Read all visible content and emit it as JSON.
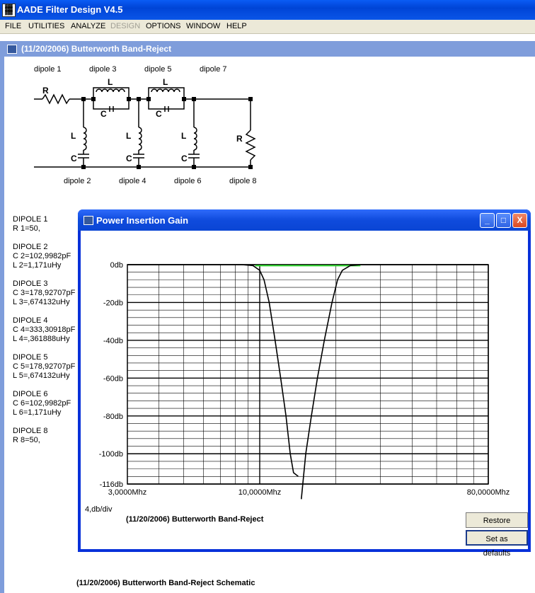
{
  "app": {
    "title": "AADE Filter Design V4.5"
  },
  "menu": [
    {
      "label": "FILE",
      "enabled": true
    },
    {
      "label": "UTILITIES",
      "enabled": true
    },
    {
      "label": "ANALYZE",
      "enabled": true
    },
    {
      "label": "DESIGN",
      "enabled": false
    },
    {
      "label": "OPTIONS",
      "enabled": true
    },
    {
      "label": "WINDOW",
      "enabled": true
    },
    {
      "label": "HELP",
      "enabled": true
    }
  ],
  "child_window": {
    "title": "(11/20/2006) Butterworth Band-Reject"
  },
  "schematic": {
    "top_labels": [
      "dipole 1",
      "dipole 3",
      "dipole 5",
      "dipole 7"
    ],
    "bottom_labels": [
      "dipole 2",
      "dipole 4",
      "dipole 6",
      "dipole 8"
    ],
    "symbols": {
      "R": "R",
      "L": "L",
      "C": "C"
    },
    "caption": "(11/20/2006) Butterworth Band-Reject Schematic"
  },
  "components": [
    {
      "name": "DIPOLE 1",
      "lines": [
        "R 1=50,"
      ]
    },
    {
      "name": "DIPOLE 2",
      "lines": [
        "C 2=102,9982pF",
        "L 2=1,171uHy"
      ]
    },
    {
      "name": "DIPOLE 3",
      "lines": [
        "C 3=178,92707pF",
        "L 3=,674132uHy"
      ]
    },
    {
      "name": "DIPOLE 4",
      "lines": [
        "C 4=333,30918pF",
        "L 4=,361888uHy"
      ]
    },
    {
      "name": "DIPOLE 5",
      "lines": [
        "C 5=178,92707pF",
        "L 5=,674132uHy"
      ]
    },
    {
      "name": "DIPOLE 6",
      "lines": [
        "C 6=102,9982pF",
        "L 6=1,171uHy"
      ]
    },
    {
      "name": "DIPOLE 8",
      "lines": [
        "R 8=50,"
      ]
    }
  ],
  "popup": {
    "title": "Power Insertion Gain",
    "scale_label": "4,db/div",
    "plot_caption": "(11/20/2006) Butterworth Band-Reject",
    "restore_label": "Restore defaults",
    "set_label": "Set as defaults",
    "controls": {
      "minimize": "_",
      "maximize": "□",
      "close": "X"
    }
  },
  "chart_data": {
    "type": "line",
    "x_scale": "log",
    "xlim": [
      3,
      80
    ],
    "ylim": [
      -116,
      0
    ],
    "x_tick_labels": [
      {
        "value": 3,
        "label": "3,0000Mhz"
      },
      {
        "value": 10,
        "label": "10,0000Mhz"
      },
      {
        "value": 80,
        "label": "80,0000Mhz"
      }
    ],
    "y_tick_labels": [
      {
        "value": 0,
        "label": "0db"
      },
      {
        "value": -20,
        "label": "-20db"
      },
      {
        "value": -40,
        "label": "-40db"
      },
      {
        "value": -60,
        "label": "-60db"
      },
      {
        "value": -80,
        "label": "-80db"
      },
      {
        "value": -100,
        "label": "-100db"
      },
      {
        "value": -116,
        "label": "-116db"
      }
    ],
    "minor_y_step": 4,
    "grid": true,
    "reference_line": {
      "y": -0.5,
      "x_range": [
        9.6,
        25
      ],
      "color": "#33dd33"
    },
    "series": [
      {
        "color": "#000000",
        "points": [
          [
            3,
            0
          ],
          [
            8.5,
            0
          ],
          [
            9.4,
            -0.5
          ],
          [
            10.0,
            -3
          ],
          [
            10.4,
            -8
          ],
          [
            10.9,
            -20
          ],
          [
            11.5,
            -40
          ],
          [
            12.1,
            -60
          ],
          [
            12.7,
            -80
          ],
          [
            13.2,
            -100
          ],
          [
            13.6,
            -110
          ],
          [
            14.2,
            -112
          ]
        ],
        "dip_x": 13.9
      },
      {
        "color": "#000000",
        "points": [
          [
            14.6,
            -124
          ],
          [
            15.2,
            -100
          ],
          [
            16.0,
            -80
          ],
          [
            16.9,
            -60
          ],
          [
            18.0,
            -40
          ],
          [
            19.3,
            -20
          ],
          [
            20.3,
            -8
          ],
          [
            21.2,
            -3
          ],
          [
            22.8,
            -0.5
          ],
          [
            25,
            0
          ],
          [
            80,
            0
          ]
        ]
      }
    ]
  }
}
